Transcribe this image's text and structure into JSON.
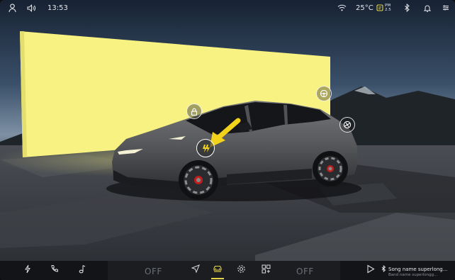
{
  "status_bar": {
    "time": "13:53",
    "temperature": "25°C",
    "profile_icon": "person-icon",
    "volume_icon": "speaker-icon",
    "wifi_icon": "wifi-icon",
    "aq_icon": "air-quality-icon",
    "aq_label": "PM 2.5",
    "bluetooth_icon": "bluetooth-icon",
    "notification_icon": "bell-icon",
    "settings_icon": "sliders-icon"
  },
  "hotspots": {
    "lock_icon": "lock-icon",
    "charge_icon": "charge-port-icon",
    "wheel_icon": "steering-wheel-icon",
    "car_icon": "car-top-icon"
  },
  "dock": {
    "left_icons": [
      "lightning-icon",
      "phone-icon",
      "music-icon"
    ],
    "climate_left": "OFF",
    "climate_right": "OFF",
    "center_icons": [
      "navigation-icon",
      "car-icon",
      "settings-gear-icon",
      "apps-grid-icon"
    ],
    "active_tab": "car-icon",
    "media": {
      "play_icon": "play-icon",
      "song": "Song name superlong...",
      "band": "Band name superlongg..."
    }
  },
  "colors": {
    "accent": "#e5d44a",
    "panel_light": "#f7f281",
    "car_body": "#5c5d5e"
  }
}
